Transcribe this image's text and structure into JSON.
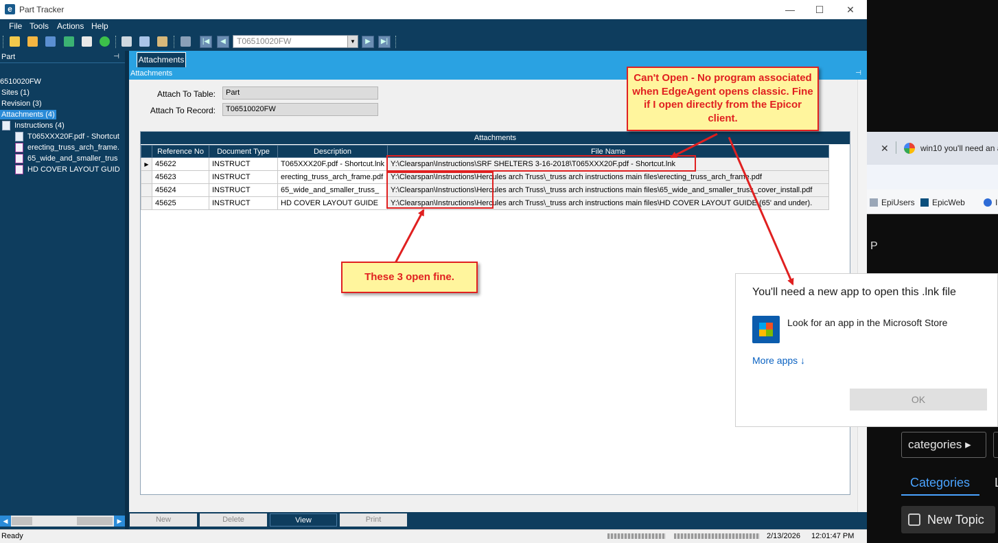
{
  "window": {
    "title": "Part Tracker",
    "logo_letter": "e",
    "minimize": "—",
    "maximize": "☐",
    "close": "✕"
  },
  "menu": [
    "File",
    "Tools",
    "Actions",
    "Help"
  ],
  "toolbar": {
    "record_combo": "T06510020FW"
  },
  "left_pane": {
    "header": "Part",
    "pin": "⊣",
    "tree": [
      {
        "label": "6510020FW"
      },
      {
        "label": "Sites (1)"
      },
      {
        "label": "Revision (3)"
      },
      {
        "label": "Attachments (4)"
      },
      {
        "label": "Instructions (4)"
      },
      {
        "label": "T065XXX20F.pdf - Shortcut"
      },
      {
        "label": "erecting_truss_arch_frame."
      },
      {
        "label": "65_wide_and_smaller_trus"
      },
      {
        "label": "HD COVER LAYOUT GUID"
      }
    ]
  },
  "tabs": [
    {
      "label": "Attachments"
    }
  ],
  "panel": {
    "header": "Attachments",
    "attach_to_table_label": "Attach To Table:",
    "attach_to_table_value": "Part",
    "attach_to_record_label": "Attach To Record:",
    "attach_to_record_value": "T06510020FW"
  },
  "grid": {
    "title": "Attachments",
    "columns": [
      "Reference No",
      "Document Type",
      "Description",
      "File Name"
    ],
    "rows": [
      {
        "ref": "45622",
        "type": "INSTRUCT",
        "desc": "T065XXX20F.pdf - Shortcut.lnk",
        "file": "Y:\\Clearspan\\Instructions\\SRF SHELTERS 3-16-2018\\T065XXX20F.pdf - Shortcut.lnk",
        "current": true
      },
      {
        "ref": "45623",
        "type": "INSTRUCT",
        "desc": "erecting_truss_arch_frame.pdf",
        "file": "Y:\\Clearspan\\Instructions\\Hercules arch Truss\\_truss arch instructions main files\\erecting_truss_arch_frame.pdf",
        "current": false
      },
      {
        "ref": "45624",
        "type": "INSTRUCT",
        "desc": "65_wide_and_smaller_truss_",
        "file": "Y:\\Clearspan\\Instructions\\Hercules arch Truss\\_truss arch instructions main files\\65_wide_and_smaller_truss_cover_install.pdf",
        "current": false
      },
      {
        "ref": "45625",
        "type": "INSTRUCT",
        "desc": "HD COVER LAYOUT GUIDE",
        "file": "Y:\\Clearspan\\Instructions\\Hercules arch Truss\\_truss arch instructions main files\\HD COVER LAYOUT GUIDE (65' and under).",
        "current": false
      }
    ]
  },
  "actions": {
    "new": "New",
    "delete": "Delete",
    "view": "View",
    "print": "Print"
  },
  "status": {
    "text": "Ready",
    "date": "2/13/2026",
    "time": "12:01:47 PM"
  },
  "dialog": {
    "title": "You'll need a new app to open this .lnk file",
    "store_option": "Look for an app in the Microsoft Store",
    "more_apps": "More apps ↓",
    "ok": "OK"
  },
  "browser": {
    "tab_close": "✕",
    "tab_title": "win10 you'll need an a",
    "bookmarks": [
      "EpiUsers",
      "EpicWeb",
      "In"
    ]
  },
  "forum": {
    "letter": "P",
    "categories_button": "categories ▸",
    "tab_categories": "Categories",
    "tab_latest": "L",
    "new_topic": "New Topic"
  },
  "annotations": {
    "cant_open": "Can't Open - No program associated when EdgeAgent opens classic. Fine if I open directly from the Epicor client.",
    "open_fine": "These 3 open fine."
  },
  "colors": {
    "epicor_navy": "#0e3d5e",
    "epicor_blue": "#2aa2e2",
    "annotation_red": "#e02020",
    "annotation_yellow": "#fff59d",
    "link_blue": "#0a62c2"
  }
}
